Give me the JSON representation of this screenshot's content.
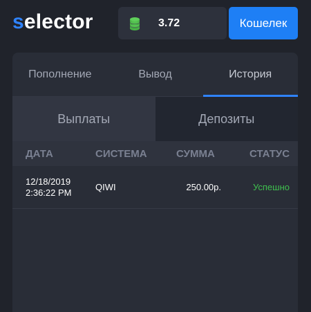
{
  "brand": {
    "logo_first": "s",
    "logo_rest": "elector"
  },
  "balance": {
    "icon": "coins-icon",
    "value": "3.72"
  },
  "wallet_button": "Кошелек",
  "tabs": [
    {
      "label": "Пополнение"
    },
    {
      "label": "Вывод"
    },
    {
      "label": "История"
    }
  ],
  "subtabs": [
    {
      "label": "Выплаты"
    },
    {
      "label": "Депозиты"
    }
  ],
  "table": {
    "headers": [
      "ДАТА",
      "СИСТЕМА",
      "СУММА",
      "СТАТУС"
    ],
    "rows": [
      {
        "date": "12/18/2019",
        "time": "2:36:22 PM",
        "system": "QIWI",
        "amount": "250.00р.",
        "status": "Успешно"
      }
    ]
  },
  "colors": {
    "accent": "#2f83ff",
    "button": "#1e7ff5",
    "success": "#3fbf4e",
    "coin": "#5fcf5a"
  }
}
